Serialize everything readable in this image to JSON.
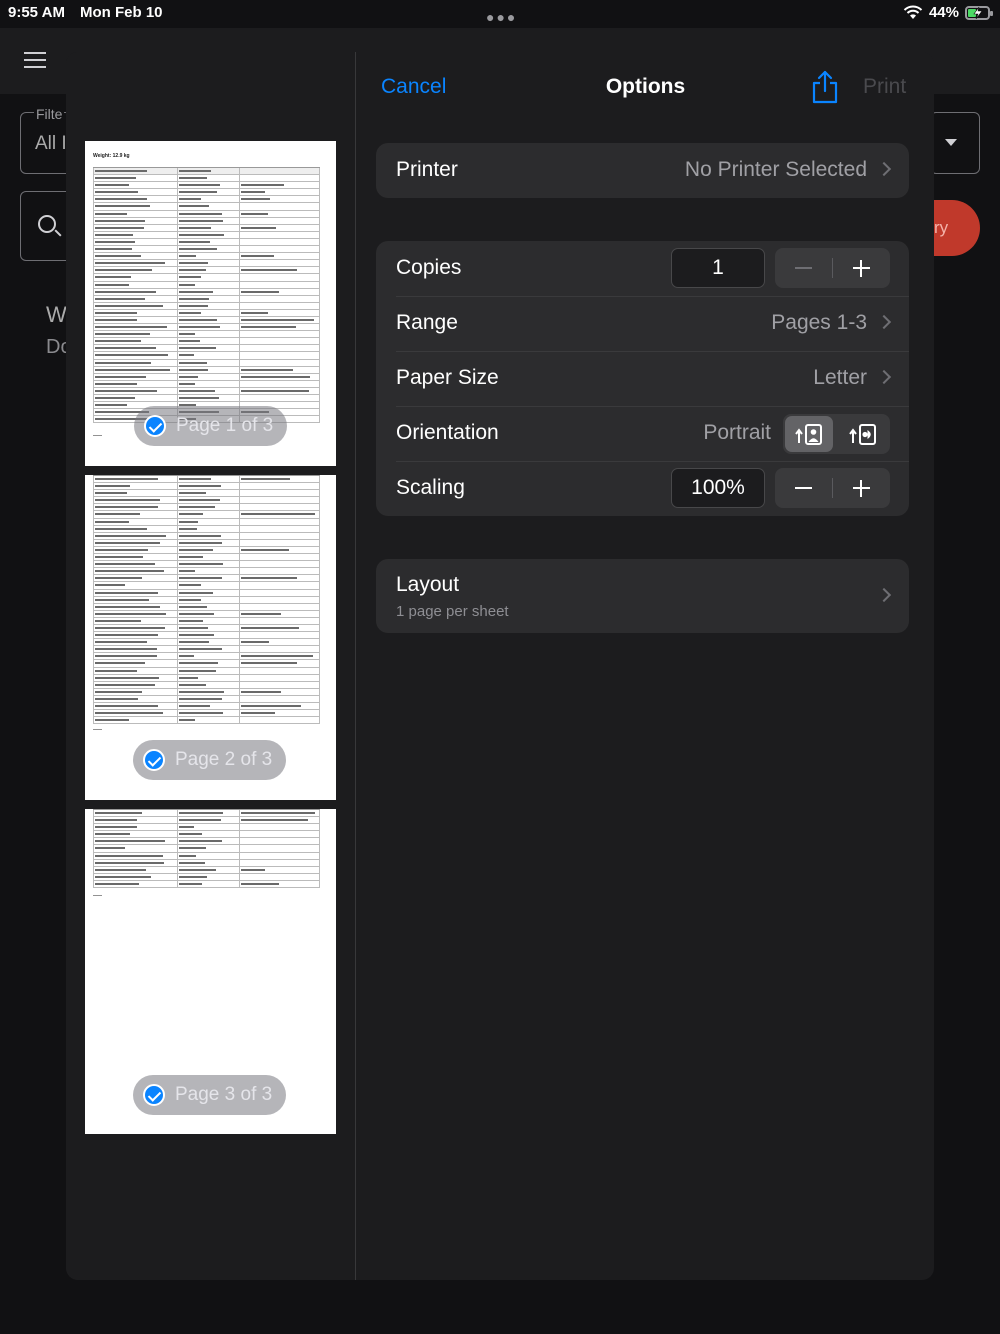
{
  "status_bar": {
    "time": "9:55 AM",
    "date": "Mon Feb 10",
    "battery_percent": "44%",
    "battery_level": 0.44,
    "colors": {
      "battery_fill": "#4cd964"
    }
  },
  "background_app": {
    "filter_label": "Filte",
    "filter_value": "All I",
    "content_line_1": "W",
    "content_line_2": "Do",
    "button_partial": "ry"
  },
  "print_sheet": {
    "nav": {
      "cancel_label": "Cancel",
      "title": "Options",
      "print_label": "Print"
    },
    "preview": {
      "page1_heading": "Weight: 12.9 kg",
      "pages": [
        {
          "label": "Page 1 of 3",
          "selected": true
        },
        {
          "label": "Page 2 of 3",
          "selected": true
        },
        {
          "label": "Page 3 of 3",
          "selected": true
        }
      ]
    },
    "printer": {
      "label": "Printer",
      "value": "No Printer Selected"
    },
    "copies": {
      "label": "Copies",
      "value": "1"
    },
    "range": {
      "label": "Range",
      "value": "Pages 1-3"
    },
    "paper_size": {
      "label": "Paper Size",
      "value": "Letter"
    },
    "orientation": {
      "label": "Orientation",
      "value": "Portrait",
      "options": [
        "portrait",
        "landscape"
      ],
      "selected": "portrait"
    },
    "scaling": {
      "label": "Scaling",
      "value": "100%"
    },
    "layout": {
      "label": "Layout",
      "sublabel": "1 page per sheet"
    },
    "colors": {
      "accent": "#0a84ff",
      "sheet_background": "#1c1c1e",
      "group_background": "#2c2c2e",
      "disabled_text": "#4a4a4e"
    }
  }
}
